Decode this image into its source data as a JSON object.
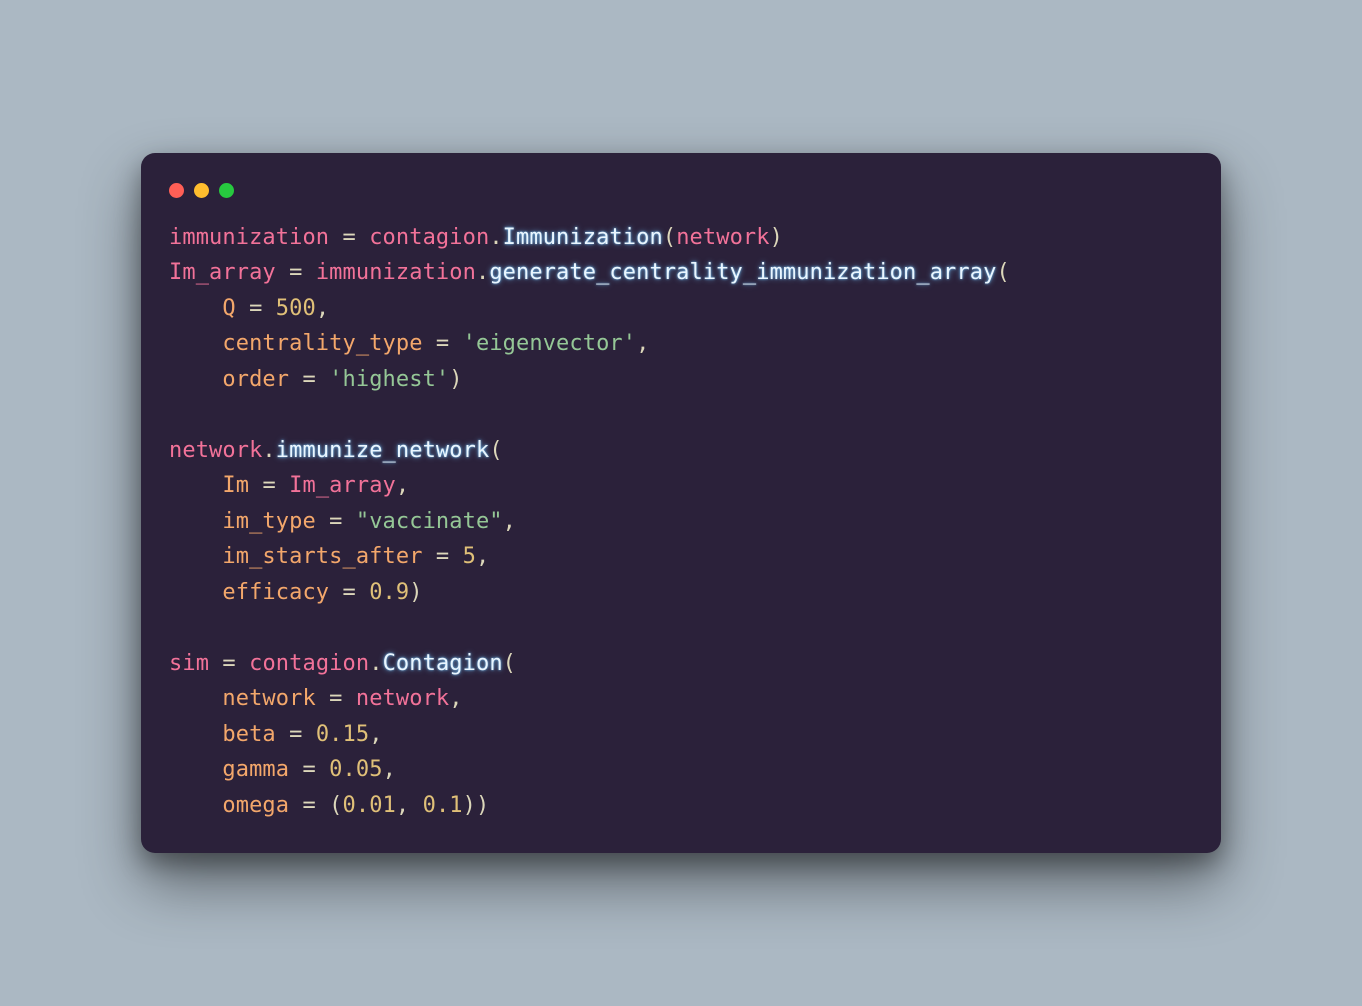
{
  "code": {
    "lines": [
      [
        {
          "cls": "tok-name",
          "t": "immunization"
        },
        {
          "cls": "tok-punct",
          "t": " = "
        },
        {
          "cls": "tok-name",
          "t": "contagion"
        },
        {
          "cls": "tok-punct",
          "t": "."
        },
        {
          "cls": "tok-method",
          "t": "Immunization"
        },
        {
          "cls": "tok-punct",
          "t": "("
        },
        {
          "cls": "tok-name",
          "t": "network"
        },
        {
          "cls": "tok-punct",
          "t": ")"
        }
      ],
      [
        {
          "cls": "tok-name",
          "t": "Im_array"
        },
        {
          "cls": "tok-punct",
          "t": " = "
        },
        {
          "cls": "tok-name",
          "t": "immunization"
        },
        {
          "cls": "tok-punct",
          "t": "."
        },
        {
          "cls": "tok-method",
          "t": "generate_centrality_immunization_array"
        },
        {
          "cls": "tok-punct",
          "t": "("
        }
      ],
      [
        {
          "cls": "tok-punct",
          "t": "    "
        },
        {
          "cls": "tok-kw",
          "t": "Q"
        },
        {
          "cls": "tok-punct",
          "t": " = "
        },
        {
          "cls": "tok-num",
          "t": "500"
        },
        {
          "cls": "tok-punct",
          "t": ","
        }
      ],
      [
        {
          "cls": "tok-punct",
          "t": "    "
        },
        {
          "cls": "tok-kw",
          "t": "centrality_type"
        },
        {
          "cls": "tok-punct",
          "t": " = "
        },
        {
          "cls": "tok-str",
          "t": "'eigenvector'"
        },
        {
          "cls": "tok-punct",
          "t": ","
        }
      ],
      [
        {
          "cls": "tok-punct",
          "t": "    "
        },
        {
          "cls": "tok-kw",
          "t": "order"
        },
        {
          "cls": "tok-punct",
          "t": " = "
        },
        {
          "cls": "tok-str",
          "t": "'highest'"
        },
        {
          "cls": "tok-punct",
          "t": ")"
        }
      ],
      [
        {
          "cls": "tok-punct",
          "t": " "
        }
      ],
      [
        {
          "cls": "tok-name",
          "t": "network"
        },
        {
          "cls": "tok-punct",
          "t": "."
        },
        {
          "cls": "tok-method",
          "t": "immunize_network"
        },
        {
          "cls": "tok-punct",
          "t": "("
        }
      ],
      [
        {
          "cls": "tok-punct",
          "t": "    "
        },
        {
          "cls": "tok-kw",
          "t": "Im"
        },
        {
          "cls": "tok-punct",
          "t": " = "
        },
        {
          "cls": "tok-name",
          "t": "Im_array"
        },
        {
          "cls": "tok-punct",
          "t": ","
        }
      ],
      [
        {
          "cls": "tok-punct",
          "t": "    "
        },
        {
          "cls": "tok-kw",
          "t": "im_type"
        },
        {
          "cls": "tok-punct",
          "t": " = "
        },
        {
          "cls": "tok-str",
          "t": "\"vaccinate\""
        },
        {
          "cls": "tok-punct",
          "t": ","
        }
      ],
      [
        {
          "cls": "tok-punct",
          "t": "    "
        },
        {
          "cls": "tok-kw",
          "t": "im_starts_after"
        },
        {
          "cls": "tok-punct",
          "t": " = "
        },
        {
          "cls": "tok-num",
          "t": "5"
        },
        {
          "cls": "tok-punct",
          "t": ","
        }
      ],
      [
        {
          "cls": "tok-punct",
          "t": "    "
        },
        {
          "cls": "tok-kw",
          "t": "efficacy"
        },
        {
          "cls": "tok-punct",
          "t": " = "
        },
        {
          "cls": "tok-num",
          "t": "0.9"
        },
        {
          "cls": "tok-punct",
          "t": ")"
        }
      ],
      [
        {
          "cls": "tok-punct",
          "t": " "
        }
      ],
      [
        {
          "cls": "tok-name",
          "t": "sim"
        },
        {
          "cls": "tok-punct",
          "t": " = "
        },
        {
          "cls": "tok-name",
          "t": "contagion"
        },
        {
          "cls": "tok-punct",
          "t": "."
        },
        {
          "cls": "tok-method",
          "t": "Contagion"
        },
        {
          "cls": "tok-punct",
          "t": "("
        }
      ],
      [
        {
          "cls": "tok-punct",
          "t": "    "
        },
        {
          "cls": "tok-kw",
          "t": "network"
        },
        {
          "cls": "tok-punct",
          "t": " = "
        },
        {
          "cls": "tok-name",
          "t": "network"
        },
        {
          "cls": "tok-punct",
          "t": ","
        }
      ],
      [
        {
          "cls": "tok-punct",
          "t": "    "
        },
        {
          "cls": "tok-kw",
          "t": "beta"
        },
        {
          "cls": "tok-punct",
          "t": " = "
        },
        {
          "cls": "tok-num",
          "t": "0.15"
        },
        {
          "cls": "tok-punct",
          "t": ","
        }
      ],
      [
        {
          "cls": "tok-punct",
          "t": "    "
        },
        {
          "cls": "tok-kw",
          "t": "gamma"
        },
        {
          "cls": "tok-punct",
          "t": " = "
        },
        {
          "cls": "tok-num",
          "t": "0.05"
        },
        {
          "cls": "tok-punct",
          "t": ","
        }
      ],
      [
        {
          "cls": "tok-punct",
          "t": "    "
        },
        {
          "cls": "tok-kw",
          "t": "omega"
        },
        {
          "cls": "tok-punct",
          "t": " = ("
        },
        {
          "cls": "tok-num",
          "t": "0.01"
        },
        {
          "cls": "tok-punct",
          "t": ", "
        },
        {
          "cls": "tok-num",
          "t": "0.1"
        },
        {
          "cls": "tok-punct",
          "t": "))"
        }
      ]
    ]
  }
}
